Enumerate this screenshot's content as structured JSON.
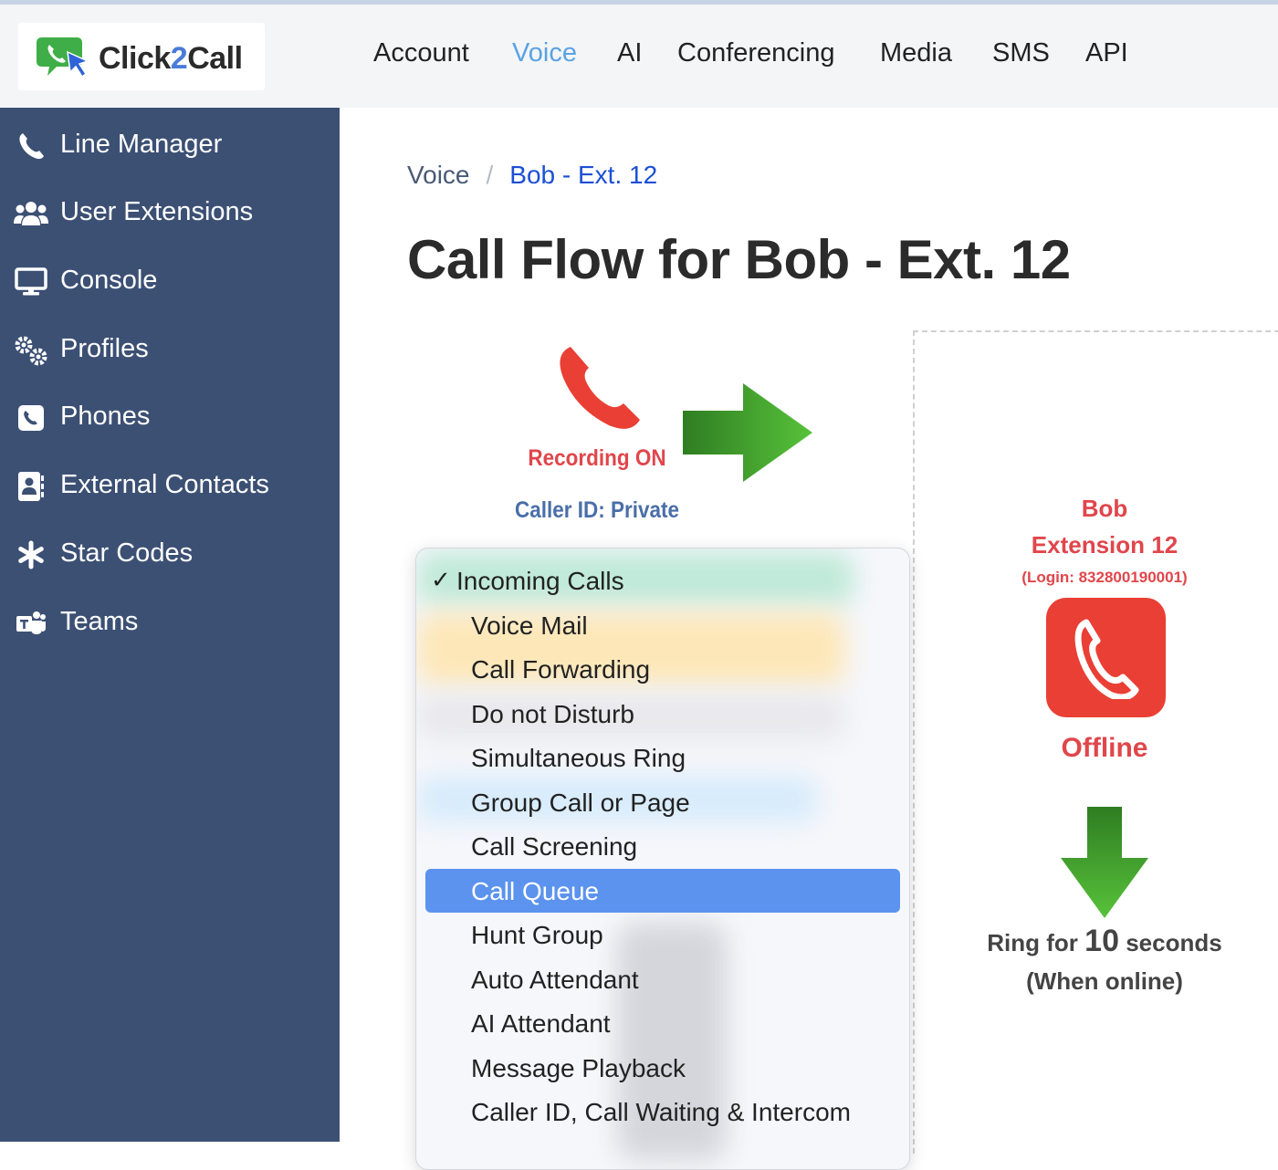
{
  "app": {
    "logo_prefix": "Click",
    "logo_two": "2",
    "logo_suffix": "Call"
  },
  "nav": [
    {
      "label": "Account",
      "active": false
    },
    {
      "label": "Voice",
      "active": true
    },
    {
      "label": "AI",
      "active": false
    },
    {
      "label": "Conferencing",
      "active": false
    },
    {
      "label": "Media",
      "active": false
    },
    {
      "label": "SMS",
      "active": false
    },
    {
      "label": "API",
      "active": false
    }
  ],
  "sidebar": {
    "items": [
      {
        "label": "Line Manager",
        "icon": "phone-icon"
      },
      {
        "label": "User Extensions",
        "icon": "users-icon"
      },
      {
        "label": "Console",
        "icon": "monitor-icon"
      },
      {
        "label": "Profiles",
        "icon": "gears-icon"
      },
      {
        "label": "Phones",
        "icon": "phone-square-icon"
      },
      {
        "label": "External Contacts",
        "icon": "address-book-icon"
      },
      {
        "label": "Star Codes",
        "icon": "asterisk-icon"
      },
      {
        "label": "Teams",
        "icon": "teams-icon"
      }
    ]
  },
  "breadcrumb": {
    "parent": "Voice",
    "separator": "/",
    "current": "Bob - Ext. 12"
  },
  "page": {
    "title": "Call Flow for Bob - Ext. 12"
  },
  "flow": {
    "recording": "Recording ON",
    "caller_id": "Caller ID: Private"
  },
  "extension": {
    "name": "Bob",
    "number": "Extension 12",
    "login": "(Login: 832800190001)",
    "status": "Offline",
    "ring_prefix": "Ring for",
    "ring_seconds": "10",
    "ring_suffix": "seconds",
    "ring_condition": "(When online)"
  },
  "dropdown": {
    "checked": "Incoming Calls",
    "highlighted": "Call Queue",
    "options": [
      "Incoming Calls",
      "Voice Mail",
      "Call Forwarding",
      "Do not Disturb",
      "Simultaneous Ring",
      "Group Call or Page",
      "Call Screening",
      "Call Queue",
      "Hunt Group",
      "Auto Attendant",
      "AI Attendant",
      "Message Playback",
      "Caller ID, Call Waiting & Intercom"
    ]
  },
  "colors": {
    "sidebar_bg": "#3c5074",
    "nav_active": "#5aa2e4",
    "alert_red": "#e0464b",
    "arrow_green": "#4caf2f",
    "selection_blue": "#5b93ee"
  }
}
